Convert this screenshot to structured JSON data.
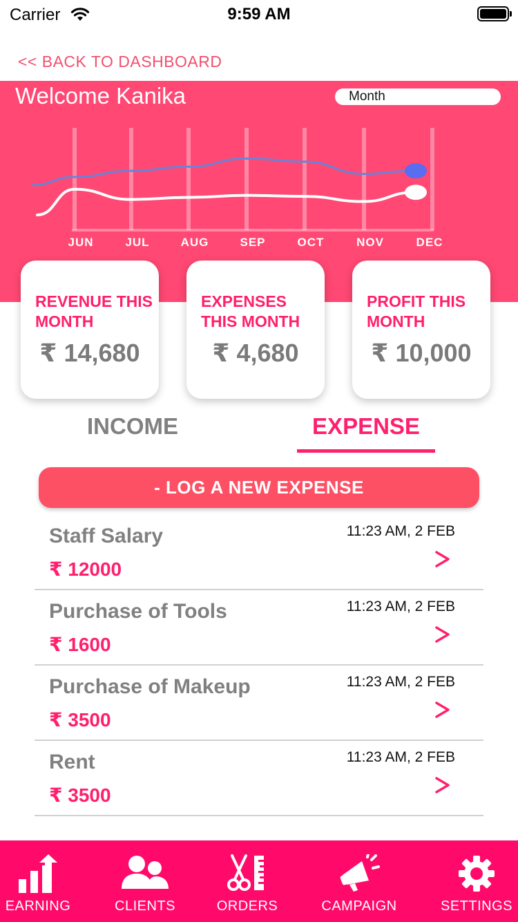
{
  "status_bar": {
    "carrier": "Carrier",
    "time": "9:59 AM"
  },
  "back_link": "<< BACK TO DASHBOARD",
  "header": {
    "welcome": "Welcome Kanika",
    "period": "Month"
  },
  "colors": {
    "brand": "#ff0a6a",
    "hero": "#ff4873",
    "accent_text": "#ff1f6d",
    "button": "#fd5064"
  },
  "chart_data": {
    "type": "line",
    "categories": [
      "JUN",
      "JUL",
      "AUG",
      "SEP",
      "OCT",
      "NOV",
      "DEC"
    ],
    "series": [
      {
        "values": [
          52,
          58,
          62,
          70,
          67,
          55,
          58
        ],
        "color": "#6b83d6"
      },
      {
        "values": [
          40,
          30,
          32,
          34,
          33,
          28,
          37
        ],
        "color": "#ffffff"
      }
    ],
    "ylim": [
      0,
      100
    ],
    "grid": "vertical"
  },
  "cards": [
    {
      "title": "REVENUE THIS MONTH",
      "value": "₹ 14,680"
    },
    {
      "title": "EXPENSES THIS MONTH",
      "value": "₹ 4,680"
    },
    {
      "title": "PROFIT THIS MONTH",
      "value": "₹ 10,000"
    }
  ],
  "tabs": {
    "income": "INCOME",
    "expense": "EXPENSE",
    "active": "expense"
  },
  "log_button": "- LOG A NEW EXPENSE",
  "expenses": [
    {
      "title": "Staff Salary",
      "amount": "₹ 12000",
      "time": "11:23 AM, 2 FEB"
    },
    {
      "title": "Purchase of Tools",
      "amount": "₹ 1600",
      "time": "11:23 AM, 2 FEB"
    },
    {
      "title": "Purchase of Makeup",
      "amount": "₹ 3500",
      "time": "11:23 AM, 2 FEB"
    },
    {
      "title": "Rent",
      "amount": "₹ 3500",
      "time": "11:23 AM, 2 FEB"
    }
  ],
  "nav": [
    {
      "label": "EARNING",
      "icon": "bar-chart-icon"
    },
    {
      "label": "CLIENTS",
      "icon": "users-icon"
    },
    {
      "label": "ORDERS",
      "icon": "scissors-icon"
    },
    {
      "label": "CAMPAIGN",
      "icon": "megaphone-icon"
    },
    {
      "label": "SETTINGS",
      "icon": "gear-icon"
    }
  ]
}
